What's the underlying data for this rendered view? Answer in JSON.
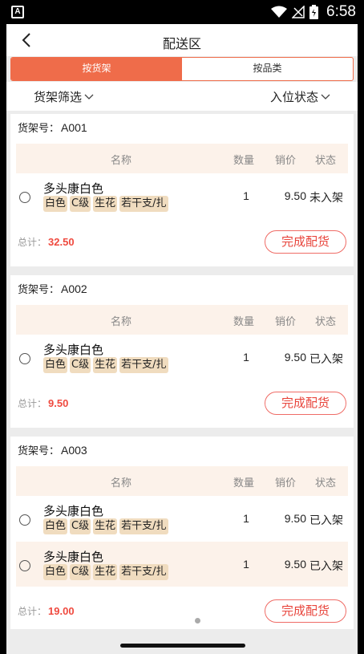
{
  "status_bar": {
    "time": "6:58",
    "app_letter": "A"
  },
  "nav": {
    "title": "配送区"
  },
  "tabs": [
    {
      "label": "按货架",
      "active": true
    },
    {
      "label": "按品类",
      "active": false
    }
  ],
  "filters": {
    "left_label": "货架筛选",
    "right_label": "入位状态"
  },
  "table_headers": {
    "name": "名称",
    "qty": "数量",
    "price": "销价",
    "state": "状态"
  },
  "shelves": [
    {
      "label": "货架号：",
      "code": "A001",
      "items": [
        {
          "name": "多头康白色",
          "tags": [
            "白色",
            "C级",
            "生花",
            "若干支/扎"
          ],
          "qty": "1",
          "price": "9.50",
          "state": "未入架"
        }
      ],
      "total_label": "总计：",
      "total": "32.50",
      "button": "完成配货"
    },
    {
      "label": "货架号：",
      "code": "A002",
      "items": [
        {
          "name": "多头康白色",
          "tags": [
            "白色",
            "C级",
            "生花",
            "若干支/扎"
          ],
          "qty": "1",
          "price": "9.50",
          "state": "已入架"
        }
      ],
      "total_label": "总计：",
      "total": "9.50",
      "button": "完成配货"
    },
    {
      "label": "货架号：",
      "code": "A003",
      "items": [
        {
          "name": "多头康白色",
          "tags": [
            "白色",
            "C级",
            "生花",
            "若干支/扎"
          ],
          "qty": "1",
          "price": "9.50",
          "state": "已入架"
        },
        {
          "name": "多头康白色",
          "tags": [
            "白色",
            "C级",
            "生花",
            "若干支/扎"
          ],
          "qty": "1",
          "price": "9.50",
          "state": "已入架"
        }
      ],
      "total_label": "总计：",
      "total": "19.00",
      "button": "完成配货"
    }
  ],
  "colors": {
    "accent": "#ef6c4a",
    "amount": "#ef4a3f",
    "header_bg": "#fcf2ea",
    "tag_bg": "#f0dcbf"
  }
}
